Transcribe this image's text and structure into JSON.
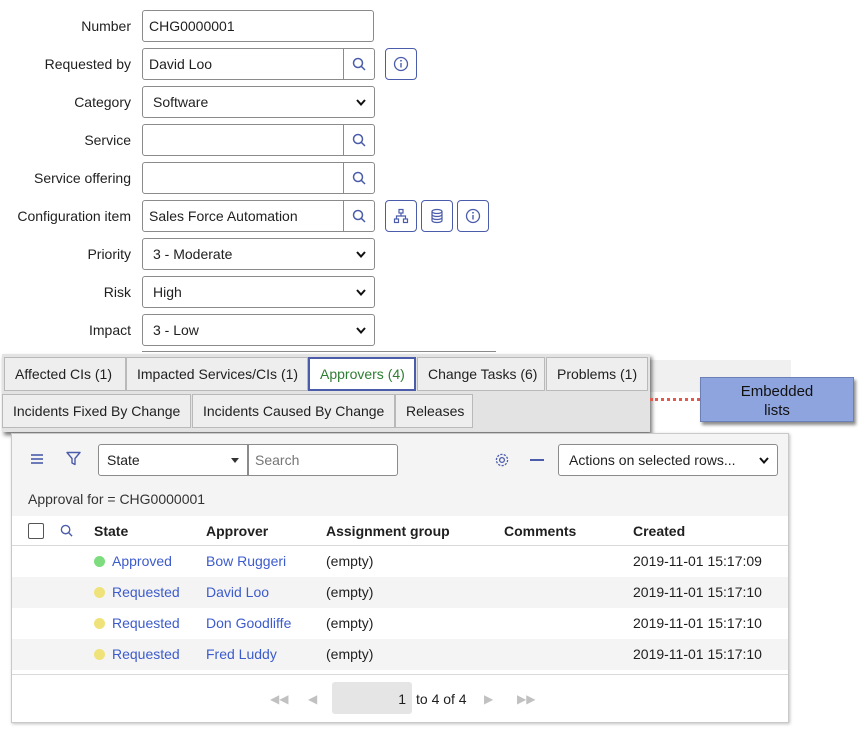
{
  "form": {
    "number": {
      "label": "Number",
      "value": "CHG0000001"
    },
    "requested_by": {
      "label": "Requested by",
      "value": "David Loo"
    },
    "category": {
      "label": "Category",
      "value": "Software"
    },
    "service": {
      "label": "Service",
      "value": ""
    },
    "service_offering": {
      "label": "Service offering",
      "value": ""
    },
    "configuration_item": {
      "label": "Configuration item",
      "value": "Sales Force Automation"
    },
    "priority": {
      "label": "Priority",
      "value": "3 - Moderate"
    },
    "risk": {
      "label": "Risk",
      "value": "High"
    },
    "impact": {
      "label": "Impact",
      "value": "3 - Low"
    }
  },
  "tabs": [
    {
      "label": "Affected CIs (1)",
      "active": false
    },
    {
      "label": "Impacted Services/CIs (1)",
      "active": false
    },
    {
      "label": "Approvers (4)",
      "active": true
    },
    {
      "label": "Change Tasks (6)",
      "active": false
    },
    {
      "label": "Problems (1)",
      "active": false
    },
    {
      "label": "Incidents Fixed By Change",
      "active": false
    },
    {
      "label": "Incidents Caused By Change",
      "active": false
    },
    {
      "label": "Releases",
      "active": false
    }
  ],
  "callout": {
    "line1": "Embedded",
    "line2": "lists"
  },
  "list": {
    "search_field": "State",
    "search_placeholder": "Search",
    "actions_label": "Actions on selected rows...",
    "filter_breadcrumb": "Approval for = CHG0000001",
    "columns": [
      "State",
      "Approver",
      "Assignment group",
      "Comments",
      "Created"
    ],
    "rows": [
      {
        "state": "Approved",
        "state_color": "#7ddc7d",
        "approver": "Bow Ruggeri",
        "assignment_group": "(empty)",
        "comments": "",
        "created": "2019-11-01 15:17:09"
      },
      {
        "state": "Requested",
        "state_color": "#f0e27a",
        "approver": "David Loo",
        "assignment_group": "(empty)",
        "comments": "",
        "created": "2019-11-01 15:17:10"
      },
      {
        "state": "Requested",
        "state_color": "#f0e27a",
        "approver": "Don Goodliffe",
        "assignment_group": "(empty)",
        "comments": "",
        "created": "2019-11-01 15:17:10"
      },
      {
        "state": "Requested",
        "state_color": "#f0e27a",
        "approver": "Fred Luddy",
        "assignment_group": "(empty)",
        "comments": "",
        "created": "2019-11-01 15:17:10"
      }
    ],
    "pagination": {
      "current_page": "1",
      "range_text": "to 4 of 4"
    }
  },
  "colors": {
    "accent": "#4b5cab",
    "link": "#3c5bcc",
    "callout_bg": "#8ea4de",
    "callout_line": "#e05a4d"
  }
}
